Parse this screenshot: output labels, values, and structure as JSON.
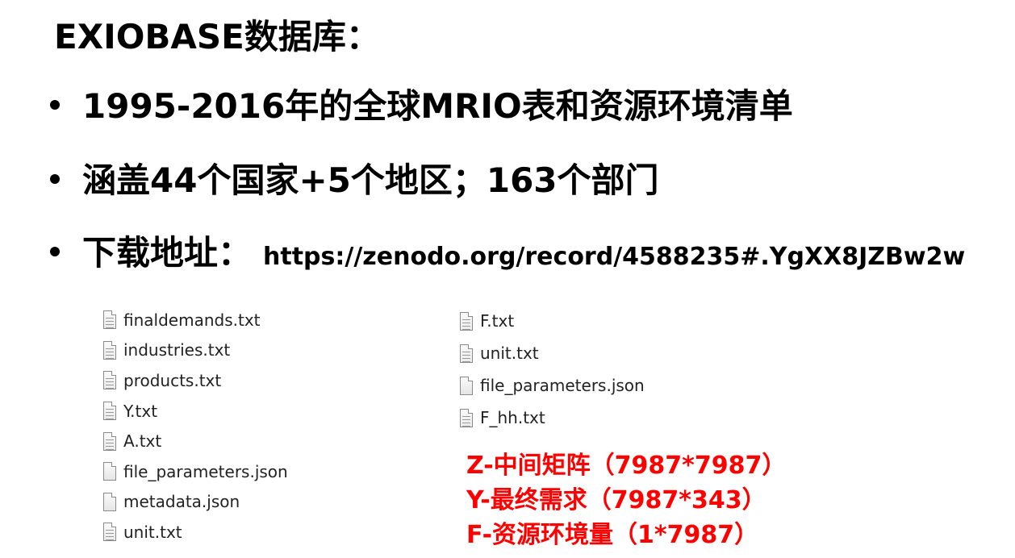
{
  "title": "EXIOBASE数据库：",
  "bullets": [
    {
      "text": "1995-2016年的全球MRIO表和资源环境清单"
    },
    {
      "text": "涵盖44个国家+5个地区；163个部门"
    },
    {
      "text": "下载地址：",
      "url": "https://zenodo.org/record/4588235#.YgXX8JZBw2w"
    }
  ],
  "files_left": [
    {
      "name": "finaldemands.txt",
      "icon": "text-file-icon"
    },
    {
      "name": "industries.txt",
      "icon": "text-file-icon"
    },
    {
      "name": "products.txt",
      "icon": "text-file-icon"
    },
    {
      "name": "Y.txt",
      "icon": "text-file-icon"
    },
    {
      "name": "A.txt",
      "icon": "text-file-icon"
    },
    {
      "name": "file_parameters.json",
      "icon": "blank-file-icon"
    },
    {
      "name": "metadata.json",
      "icon": "blank-file-icon"
    },
    {
      "name": "unit.txt",
      "icon": "text-file-icon"
    }
  ],
  "files_right": [
    {
      "name": "F.txt",
      "icon": "text-file-icon"
    },
    {
      "name": "unit.txt",
      "icon": "text-file-icon"
    },
    {
      "name": "file_parameters.json",
      "icon": "blank-file-icon"
    },
    {
      "name": "F_hh.txt",
      "icon": "text-file-icon"
    }
  ],
  "notes": [
    "Z-中间矩阵（7987*7987）",
    "Y-最终需求（7987*343）",
    "F-资源环境量（1*7987）"
  ],
  "colors": {
    "text": "#000000",
    "note": "#ff0000",
    "file_text": "#222222"
  }
}
